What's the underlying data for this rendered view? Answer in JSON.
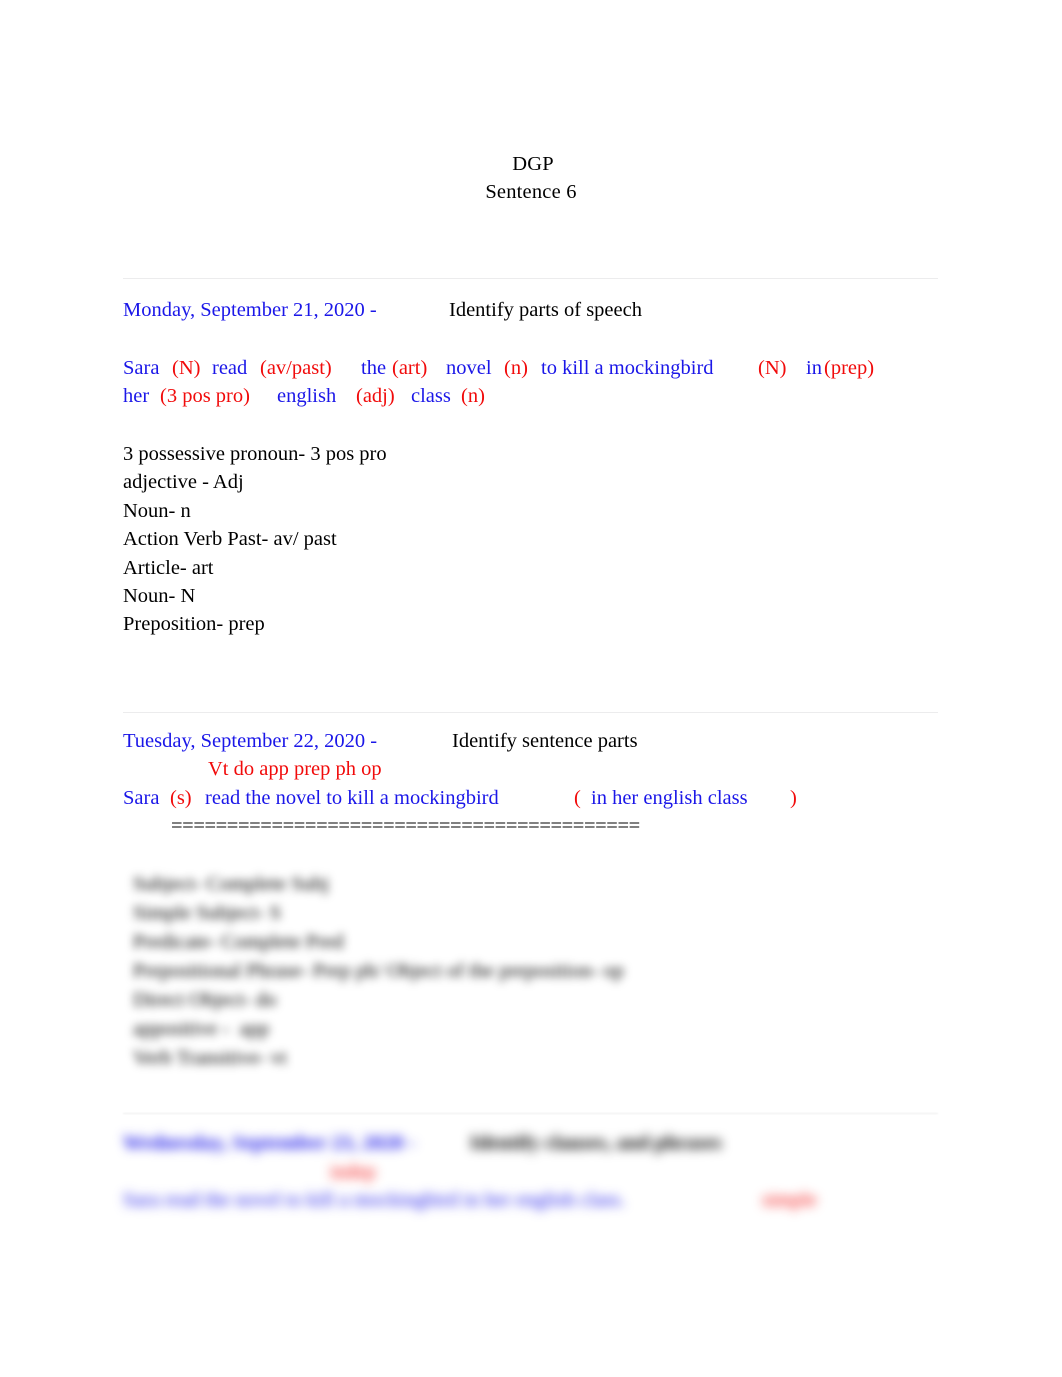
{
  "document": {
    "title_line_1": "DGP",
    "title_line_2": "Sentence 6"
  },
  "sections": [
    {
      "id": "monday",
      "date": "Monday, September 21, 2020 -",
      "instruction": "Identify parts of speech",
      "sentence_line_1": [
        {
          "text": "Sara",
          "color": "blue"
        },
        {
          "text": "(N)",
          "color": "red"
        },
        {
          "text": "read",
          "color": "blue"
        },
        {
          "text": "(av/past)",
          "color": "red"
        },
        {
          "text": "the",
          "color": "blue"
        },
        {
          "text": "(art)",
          "color": "red"
        },
        {
          "text": "novel",
          "color": "blue"
        },
        {
          "text": "(n)",
          "color": "red"
        },
        {
          "text": "to kill a mockingbird",
          "color": "blue"
        },
        {
          "text": "(N)",
          "color": "red"
        },
        {
          "text": "in",
          "color": "blue"
        },
        {
          "text": "(prep)",
          "color": "red"
        }
      ],
      "sentence_line_2": [
        {
          "text": "her",
          "color": "blue"
        },
        {
          "text": "(3 pos pro)",
          "color": "red"
        },
        {
          "text": "english",
          "color": "blue"
        },
        {
          "text": "(adj)",
          "color": "red"
        },
        {
          "text": "class",
          "color": "blue"
        },
        {
          "text": "(n)",
          "color": "red"
        }
      ],
      "legend": [
        "3 possessive pronoun- 3 pos pro",
        "adjective - Adj",
        "Noun- n",
        "Action Verb Past- av/ past",
        "Article- art",
        "Noun- N",
        "Preposition- prep"
      ]
    },
    {
      "id": "tuesday",
      "date": "Tuesday, September 22, 2020 -",
      "instruction": "Identify sentence parts",
      "labels_line": "Vt do app prep ph op",
      "sentence_line": [
        {
          "text": "Sara",
          "color": "blue"
        },
        {
          "text": "(s)",
          "color": "red"
        },
        {
          "text": "read the novel to kill a mockingbird",
          "color": "blue"
        },
        {
          "text": "(",
          "color": "red"
        },
        {
          "text": "in her english class",
          "color": "blue"
        },
        {
          "text": ")",
          "color": "red"
        }
      ],
      "underline": "==========================================",
      "legend": [
        "Subject- Complete Subj",
        "Simple Subject- S",
        "Predicate- Complete Pred",
        "Prepositional Phrase- Prep ph/ Object of the preposition- op",
        "Direct Object- do",
        "appositive -  app",
        "Verb Transitive- vt"
      ]
    },
    {
      "id": "wednesday",
      "date": "Wednesday, September 23, 2020 -",
      "instruction": "Identify clauses, and phrases",
      "annotation": "indep",
      "sentence_line": [
        {
          "text": "Sara read the novel to kill a mockingbird in her english class.",
          "color": "blue"
        }
      ],
      "trailing_label": "simple"
    }
  ],
  "colors": {
    "blue": "#1b17e8",
    "red": "#f10b0b",
    "black": "#000000",
    "rule": "#ececed"
  }
}
